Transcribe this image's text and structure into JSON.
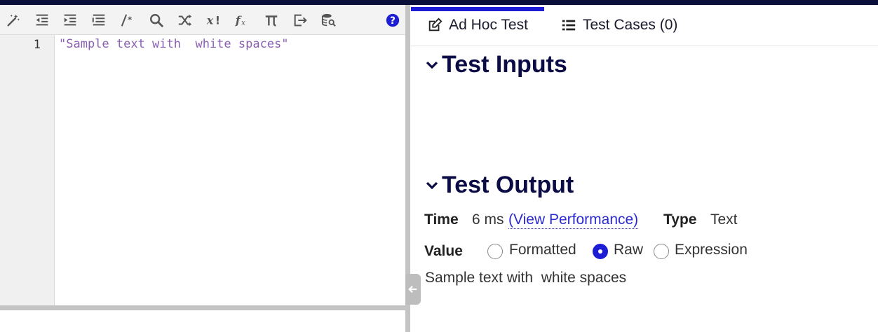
{
  "editor": {
    "line_numbers": [
      "1"
    ],
    "code_lines": [
      "\"Sample text with  white spaces\""
    ],
    "toolbar_icons": [
      "magic-wand-icon",
      "outdent-icon",
      "indent-icon",
      "list-icon",
      "comment-icon",
      "search-icon",
      "shuffle-icon",
      "variable-icon",
      "function-icon",
      "pi-icon",
      "export-icon",
      "database-search-icon",
      "help-icon"
    ]
  },
  "tabs": [
    {
      "label": "Ad Hoc Test",
      "icon": "edit-icon",
      "active": true
    },
    {
      "label": "Test Cases (0)",
      "icon": "list-icon",
      "active": false
    }
  ],
  "sections": {
    "inputs_title": "Test Inputs",
    "output_title": "Test Output"
  },
  "output": {
    "time_label": "Time",
    "time_value": "6 ms",
    "performance_link": "(View Performance)",
    "type_label": "Type",
    "type_value": "Text",
    "value_label": "Value",
    "value_options": [
      "Formatted",
      "Raw",
      "Expression"
    ],
    "selected_option": "Raw",
    "result_text": "Sample text with  white spaces"
  },
  "colors": {
    "accent": "#1d1dd6",
    "heading": "#0b0b45",
    "code_string": "#8a5fb3",
    "help_icon": "#1d1dd6"
  }
}
